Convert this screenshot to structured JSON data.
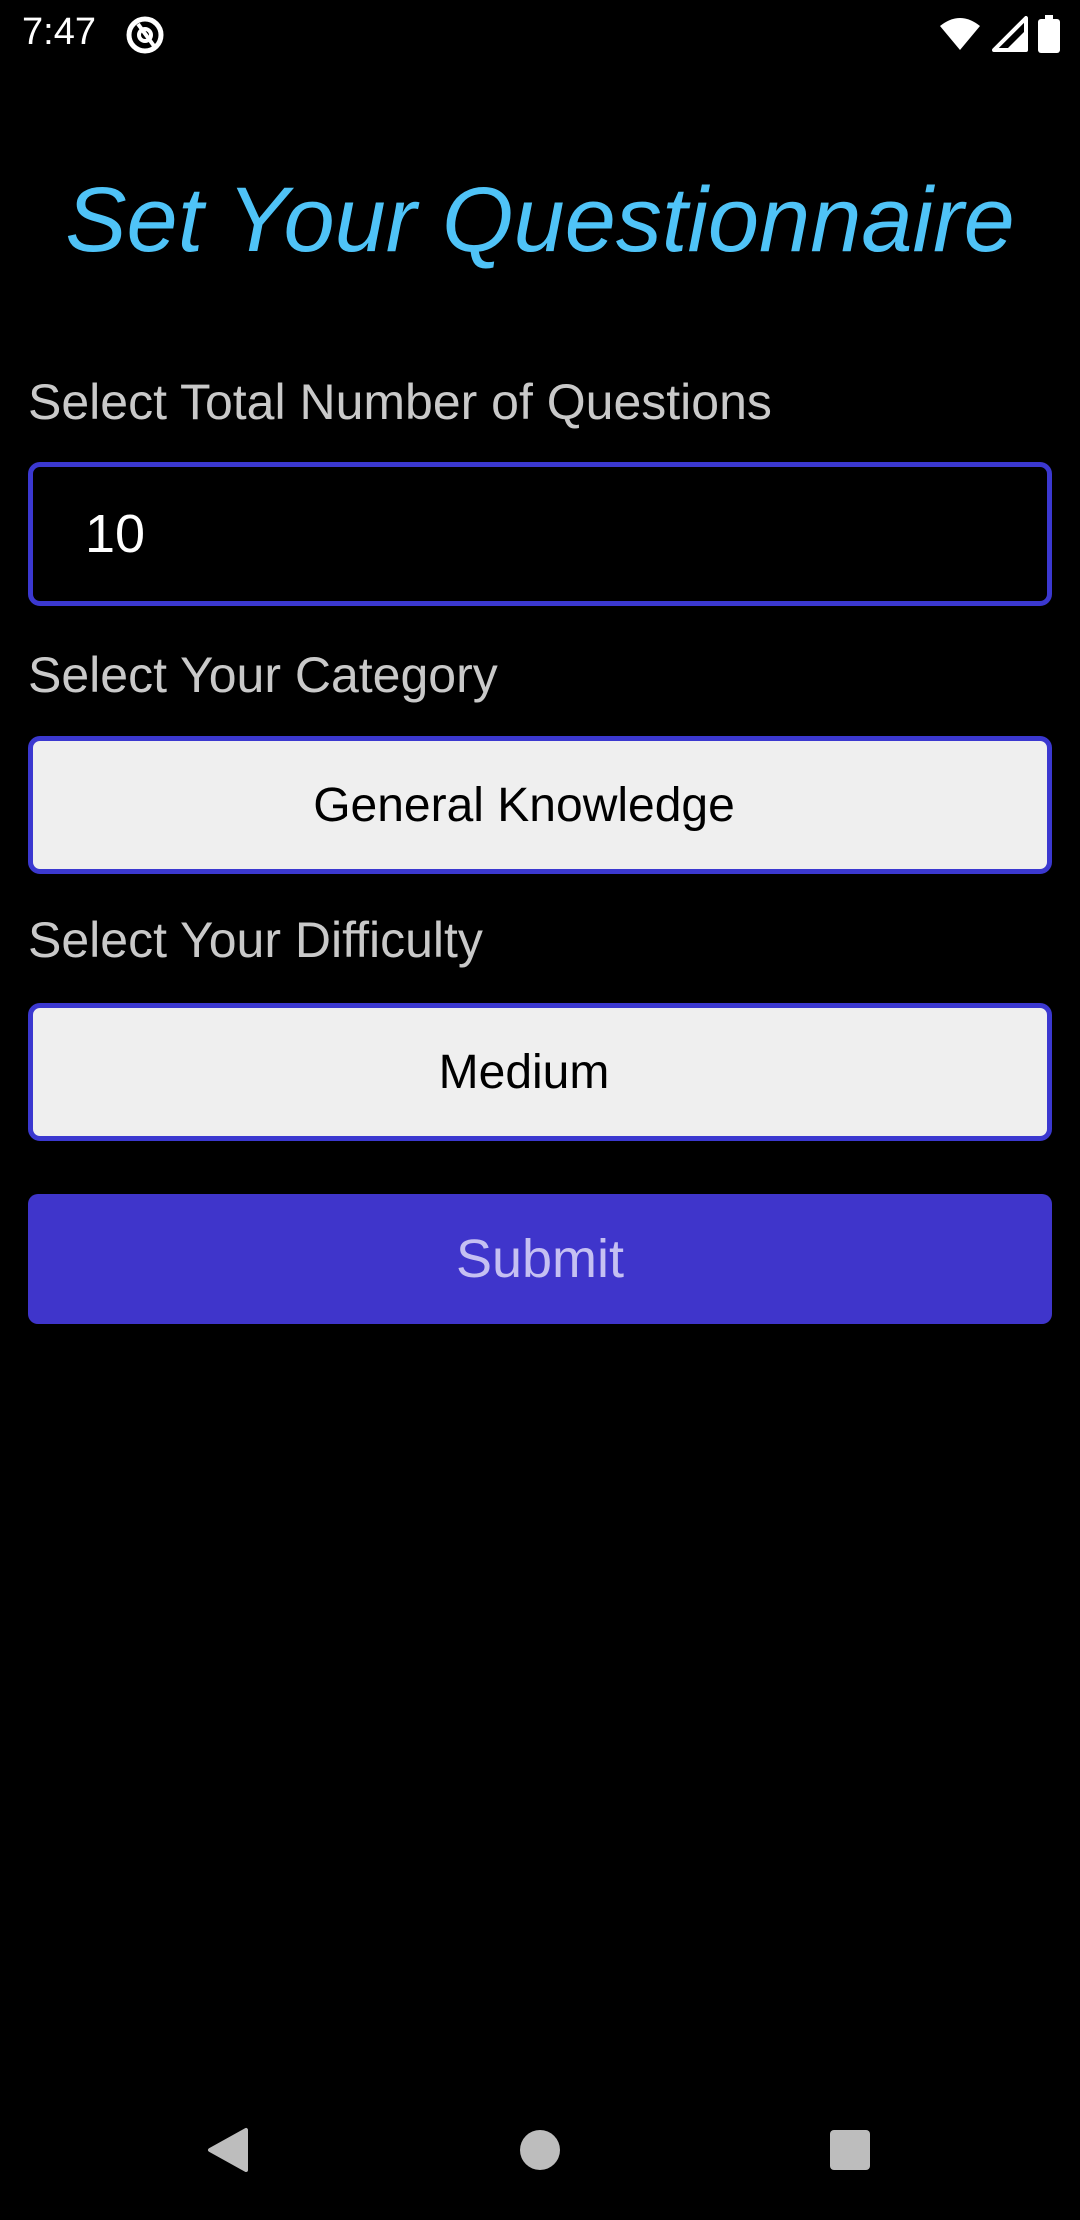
{
  "status_bar": {
    "time": "7:47",
    "icons": [
      "app-notification-icon",
      "wifi-icon",
      "signal-icon",
      "battery-icon"
    ]
  },
  "page": {
    "title": "Set Your Questionnaire"
  },
  "form": {
    "questions_label": "Select Total Number of Questions",
    "questions_value": "10",
    "category_label": "Select Your Category",
    "category_value": "General Knowledge",
    "difficulty_label": "Select Your Difficulty",
    "difficulty_value": "Medium",
    "submit_label": "Submit"
  },
  "nav_bar": {
    "buttons": [
      "back-icon",
      "home-icon",
      "recents-icon"
    ]
  },
  "colors": {
    "background": "#000000",
    "title": "#4fc3f7",
    "accent": "#3f35cb",
    "field_border": "#3b38d0",
    "select_background": "#efefef",
    "label": "#c9c9c9"
  }
}
